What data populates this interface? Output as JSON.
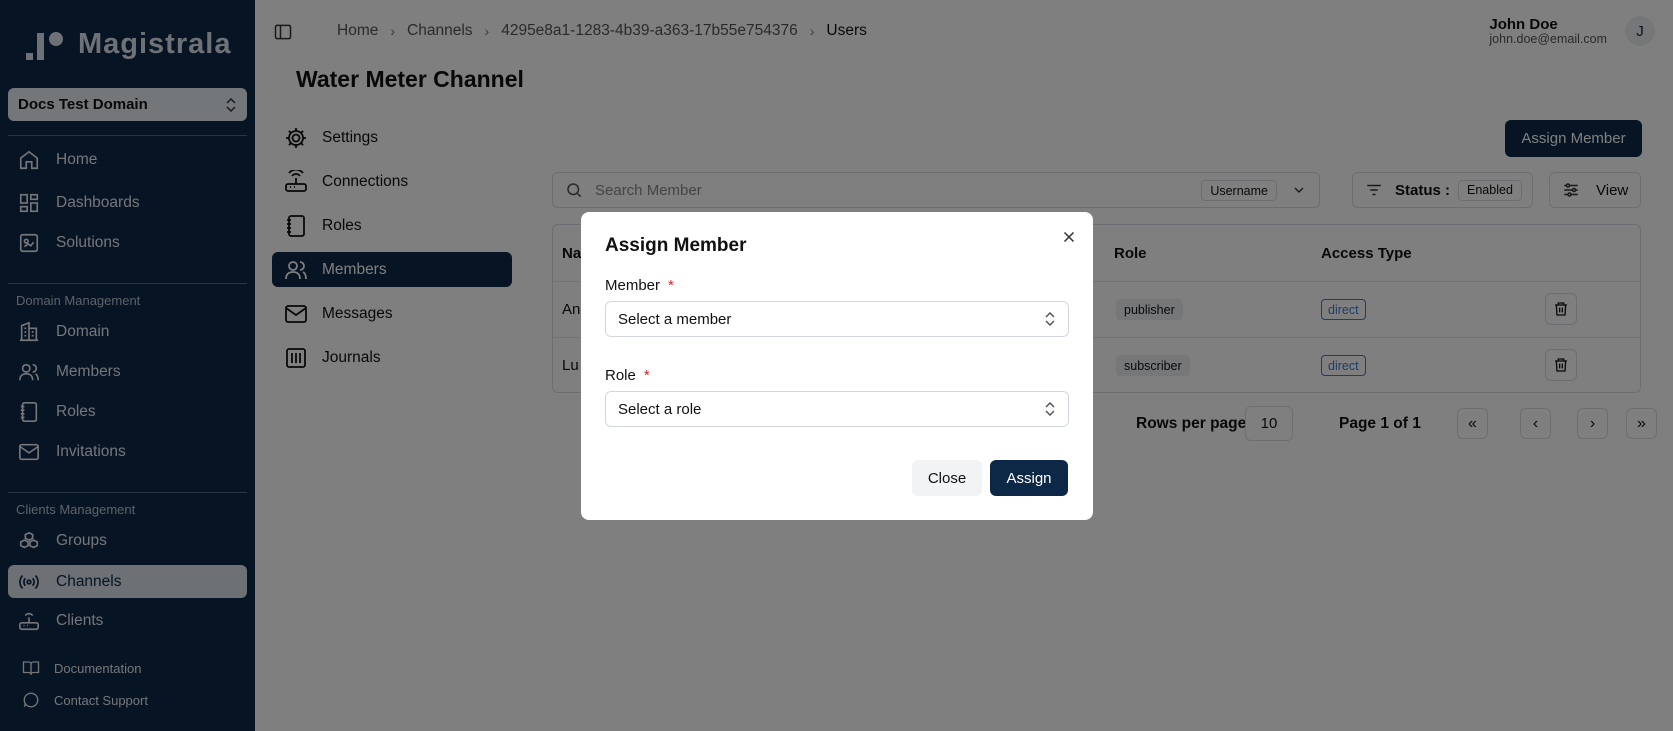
{
  "brand": {
    "name": "Magistrala"
  },
  "sidebar": {
    "domain_select": "Docs Test Domain",
    "main_items": [
      {
        "label": "Home",
        "icon": "home-icon"
      },
      {
        "label": "Dashboards",
        "icon": "dashboard-icon"
      },
      {
        "label": "Solutions",
        "icon": "solutions-icon"
      }
    ],
    "domain_section_label": "Domain Management",
    "domain_items": [
      {
        "label": "Domain",
        "icon": "building-icon"
      },
      {
        "label": "Members",
        "icon": "users-icon"
      },
      {
        "label": "Roles",
        "icon": "notebook-icon"
      },
      {
        "label": "Invitations",
        "icon": "mail-icon"
      }
    ],
    "clients_section_label": "Clients Management",
    "clients_items": [
      {
        "label": "Groups",
        "icon": "groups-icon"
      },
      {
        "label": "Channels",
        "icon": "radio-icon"
      },
      {
        "label": "Clients",
        "icon": "router-icon"
      }
    ],
    "footer": [
      {
        "label": "Documentation",
        "icon": "book-icon"
      },
      {
        "label": "Contact Support",
        "icon": "chat-icon"
      }
    ]
  },
  "header": {
    "breadcrumb": [
      "Home",
      "Channels",
      "4295e8a1-1283-4b39-a363-17b55e754376",
      "Users"
    ],
    "user_name": "John Doe",
    "user_email": "john.doe@email.com",
    "avatar_initial": "J"
  },
  "page": {
    "title": "Water Meter Channel",
    "subnav": [
      {
        "label": "Settings"
      },
      {
        "label": "Connections"
      },
      {
        "label": "Roles"
      },
      {
        "label": "Members"
      },
      {
        "label": "Messages"
      },
      {
        "label": "Journals"
      }
    ],
    "assign_member_button": "Assign Member",
    "search_placeholder": "Search Member",
    "search_filter": "Username",
    "status_label": "Status :",
    "status_value": "Enabled",
    "view_label": "View"
  },
  "table": {
    "headers": {
      "name": "Na",
      "role": "Role",
      "access": "Access Type"
    },
    "rows": [
      {
        "name": "An",
        "role": "publisher",
        "access": "direct"
      },
      {
        "name": "Lu",
        "role": "subscriber",
        "access": "direct"
      }
    ]
  },
  "pagination": {
    "rows_label": "Rows per page",
    "rows_value": "10",
    "page_label": "Page 1 of 1",
    "first": "«",
    "prev": "‹",
    "next": "›",
    "last": "»"
  },
  "modal": {
    "title": "Assign Member",
    "member_label": "Member",
    "member_placeholder": "Select a member",
    "role_label": "Role",
    "role_placeholder": "Select a role",
    "required_mark": "*",
    "close_button": "Close",
    "assign_button": "Assign"
  }
}
